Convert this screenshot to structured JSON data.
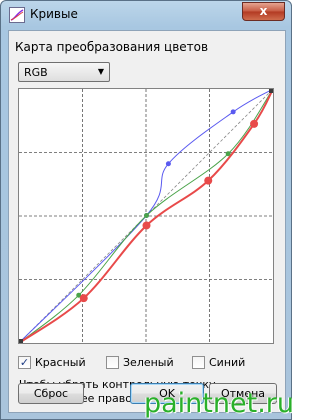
{
  "window": {
    "title": "Кривые",
    "close_glyph": "x"
  },
  "section": {
    "label": "Карта преобразования цветов"
  },
  "channel_select": {
    "value": "RGB"
  },
  "channels": [
    {
      "label": "Красный",
      "checked": true,
      "check_glyph": "✓"
    },
    {
      "label": "Зеленый",
      "checked": false,
      "check_glyph": ""
    },
    {
      "label": "Синий",
      "checked": false,
      "check_glyph": ""
    }
  ],
  "hint": "Чтобы убрать контрольную точку, щелкните ее правой кнопкой мыши.",
  "buttons": {
    "reset": "Сброс",
    "ok": "OK",
    "cancel": "Отмена"
  },
  "watermark": "paintnet.ru",
  "colors": {
    "red": "#e84a4a",
    "green": "#4aa34a",
    "blue": "#5a5af0",
    "grid": "#555555"
  },
  "curves": {
    "red": [
      [
        0,
        0
      ],
      [
        65,
        45
      ],
      [
        128,
        118
      ],
      [
        190,
        163
      ],
      [
        236,
        220
      ],
      [
        255,
        255
      ]
    ],
    "green": [
      [
        0,
        0
      ],
      [
        60,
        48
      ],
      [
        128,
        128
      ],
      [
        210,
        190
      ],
      [
        255,
        255
      ]
    ],
    "blue": [
      [
        0,
        0
      ],
      [
        128,
        128
      ],
      [
        150,
        180
      ],
      [
        215,
        232
      ],
      [
        255,
        255
      ]
    ]
  }
}
